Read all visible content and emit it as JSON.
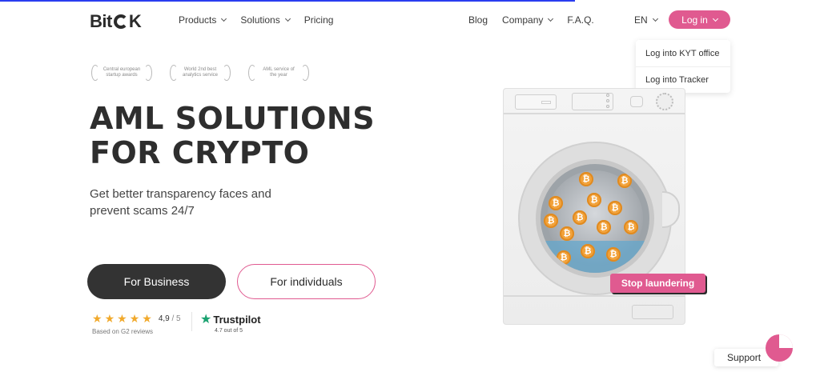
{
  "colors": {
    "accent": "#e05a90",
    "dark": "#333333",
    "star": "#f1a92b",
    "trustpilot_green": "#1aa270",
    "coin": "#f2a23a",
    "progress": "#2a3df0"
  },
  "header": {
    "logo": {
      "prefix": "Bit",
      "suffix": "K"
    },
    "nav_left": [
      {
        "label": "Products",
        "has_dropdown": true
      },
      {
        "label": "Solutions",
        "has_dropdown": true
      },
      {
        "label": "Pricing",
        "has_dropdown": false
      }
    ],
    "nav_right": [
      {
        "label": "Blog",
        "has_dropdown": false
      },
      {
        "label": "Company",
        "has_dropdown": true
      },
      {
        "label": "F.A.Q.",
        "has_dropdown": false
      }
    ],
    "language": "EN",
    "login_label": "Log in"
  },
  "login_dropdown": {
    "items": [
      {
        "label": "Log into KYT office"
      },
      {
        "label": "Log into Tracker"
      }
    ]
  },
  "awards": [
    {
      "text": "Central european startup awards"
    },
    {
      "text": "World 2nd best analytics service"
    },
    {
      "text": "AML service of the year"
    }
  ],
  "hero": {
    "title_line1": "AML SOLUTIONS",
    "title_line2": "FOR CRYPTO",
    "subtitle_line1": "Get better transparency faces and",
    "subtitle_line2": "prevent scams 24/7",
    "btn_business": "For Business",
    "btn_individuals": "For individuals"
  },
  "rating": {
    "stars": 5,
    "score": "4,9",
    "out_of": "/ 5",
    "source": "Based on G2 reviews"
  },
  "trustpilot": {
    "name": "Trustpilot",
    "score": "4.7 out of 5"
  },
  "illustration": {
    "coin_symbol": "₿",
    "stop_label": "Stop laundering"
  },
  "support": {
    "label": "Support"
  }
}
